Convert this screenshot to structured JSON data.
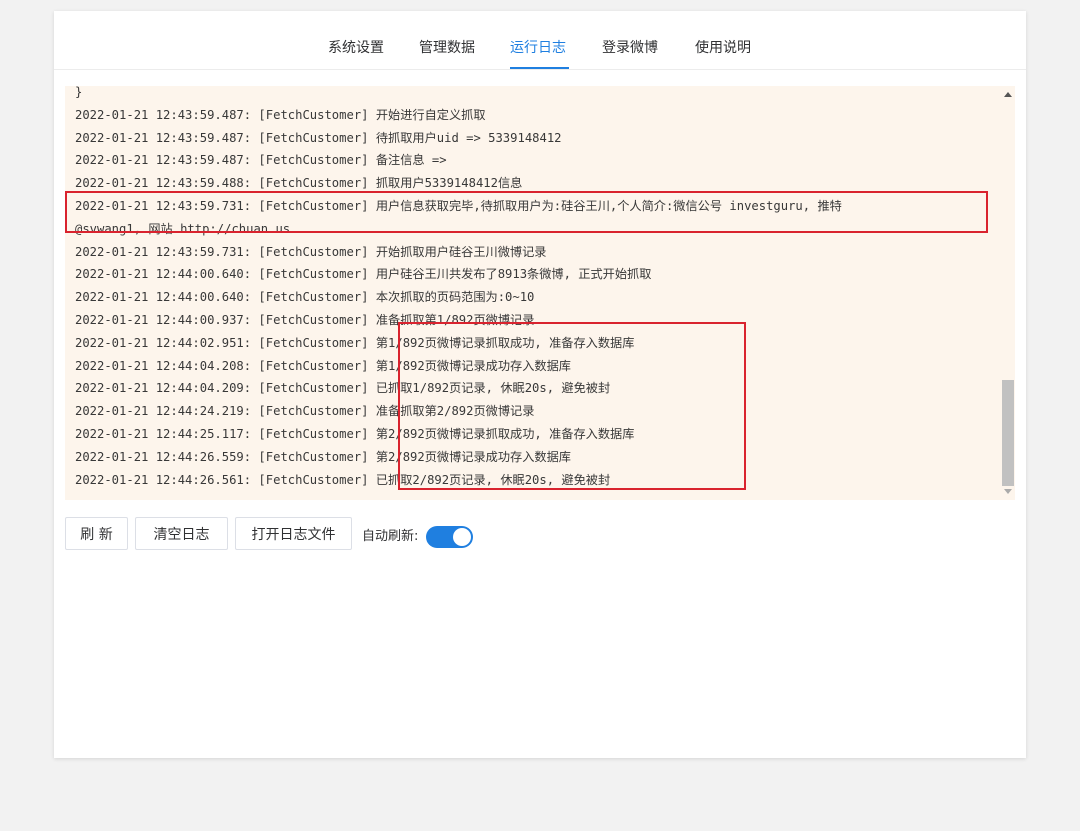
{
  "tabs": [
    {
      "label": "系统设置"
    },
    {
      "label": "管理数据"
    },
    {
      "label": "运行日志",
      "active": true
    },
    {
      "label": "登录微博"
    },
    {
      "label": "使用说明"
    }
  ],
  "log": {
    "lines": [
      "}",
      "2022-01-21 12:43:59.487: [FetchCustomer] 开始进行自定义抓取",
      "2022-01-21 12:43:59.487: [FetchCustomer] 待抓取用户uid => 5339148412",
      "2022-01-21 12:43:59.487: [FetchCustomer] 备注信息 =>",
      "2022-01-21 12:43:59.488: [FetchCustomer] 抓取用户5339148412信息",
      "2022-01-21 12:43:59.731: [FetchCustomer] 用户信息获取完毕,待抓取用户为:硅谷王川,个人简介:微信公号 investguru, 推特",
      "@svwang1, 网站 http://chuan.us",
      "2022-01-21 12:43:59.731: [FetchCustomer] 开始抓取用户硅谷王川微博记录",
      "2022-01-21 12:44:00.640: [FetchCustomer] 用户硅谷王川共发布了8913条微博, 正式开始抓取",
      "2022-01-21 12:44:00.640: [FetchCustomer] 本次抓取的页码范围为:0~10",
      "2022-01-21 12:44:00.937: [FetchCustomer] 准备抓取第1/892页微博记录",
      "2022-01-21 12:44:02.951: [FetchCustomer] 第1/892页微博记录抓取成功, 准备存入数据库",
      "2022-01-21 12:44:04.208: [FetchCustomer] 第1/892页微博记录成功存入数据库",
      "2022-01-21 12:44:04.209: [FetchCustomer] 已抓取1/892页记录, 休眠20s, 避免被封",
      "2022-01-21 12:44:24.219: [FetchCustomer] 准备抓取第2/892页微博记录",
      "2022-01-21 12:44:25.117: [FetchCustomer] 第2/892页微博记录抓取成功, 准备存入数据库",
      "2022-01-21 12:44:26.559: [FetchCustomer] 第2/892页微博记录成功存入数据库",
      "2022-01-21 12:44:26.561: [FetchCustomer] 已抓取2/892页记录, 休眠20s, 避免被封"
    ]
  },
  "toolbar": {
    "refresh_label": "刷 新",
    "clear_label": "清空日志",
    "open_file_label": "打开日志文件",
    "auto_refresh_label": "自动刷新:",
    "auto_refresh_on": true
  },
  "colors": {
    "accent": "#1f7fe0",
    "log_background": "#fdf5ec",
    "highlight_border": "#d9232e"
  }
}
